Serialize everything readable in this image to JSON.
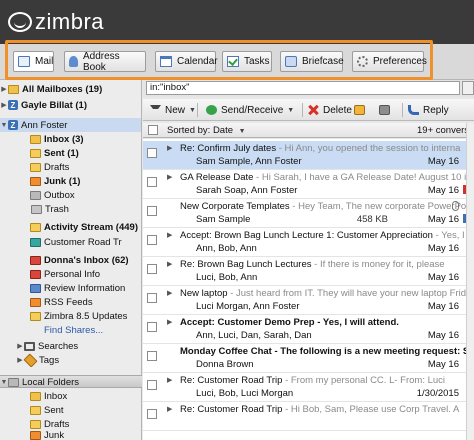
{
  "app": {
    "logo": "zimbra"
  },
  "tabs": [
    {
      "label": "Mail",
      "icon": "mail-icon"
    },
    {
      "label": "Address Book",
      "icon": "contacts-icon"
    },
    {
      "label": "Calendar",
      "icon": "calendar-icon"
    },
    {
      "label": "Tasks",
      "icon": "tasks-icon"
    },
    {
      "label": "Briefcase",
      "icon": "briefcase-icon"
    },
    {
      "label": "Preferences",
      "icon": "gear-icon"
    }
  ],
  "highlight_color": "#f0902a",
  "sidebar": {
    "top": [
      {
        "label": "All Mailboxes (19)"
      },
      {
        "label": "Gayle Billat (1)"
      },
      {
        "label": "Ann Foster"
      }
    ],
    "folders": [
      {
        "label": "Inbox (3)",
        "bold": true
      },
      {
        "label": "Sent (1)",
        "bold": true
      },
      {
        "label": "Drafts"
      },
      {
        "label": "Junk (1)",
        "bold": true
      },
      {
        "label": "Outbox"
      },
      {
        "label": "Trash"
      },
      {
        "label": "Activity Stream (449)",
        "bold": true
      },
      {
        "label": "Customer Road Tr"
      },
      {
        "label": "Donna's Inbox (62)",
        "bold": true
      },
      {
        "label": "Personal Info"
      },
      {
        "label": "Review Information"
      },
      {
        "label": "RSS Feeds"
      },
      {
        "label": "Zimbra 8.5 Updates"
      },
      {
        "label": "Find Shares..."
      },
      {
        "label": "Searches"
      },
      {
        "label": "Tags"
      }
    ],
    "local": {
      "header": "Local Folders",
      "items": [
        {
          "label": "Inbox"
        },
        {
          "label": "Sent"
        },
        {
          "label": "Drafts"
        },
        {
          "label": "Junk"
        }
      ]
    }
  },
  "search": {
    "query": "in:\"inbox\""
  },
  "toolbar": {
    "new": "New",
    "send_receive": "Send/Receive",
    "delete": "Delete",
    "reply": "Reply"
  },
  "list": {
    "sort_label": "Sorted by: Date",
    "count_label": "19+ conversati",
    "messages": [
      {
        "subject": "Re: Confirm July dates",
        "fragment": " - Hi Ann, you opened the session to interna",
        "from": "Sam Sample, Ann Foster",
        "date": "May 16",
        "selected": true,
        "unread": false,
        "arrow": true,
        "flag": ""
      },
      {
        "subject": "GA Release Date",
        "fragment": " - Hi Sarah, I have a GA Release Date! August 10 is the",
        "from": "Sarah Soap, Ann Foster",
        "date": "May 16",
        "unread": false,
        "arrow": true,
        "flag": "red"
      },
      {
        "subject": "New Corporate Templates",
        "fragment": " - Hey Team, The new corporate PowerPo",
        "from": "Sam Sample",
        "size": "458 KB",
        "date": "May 16",
        "unread": false,
        "arrow": false,
        "clip": true,
        "flag": "blue"
      },
      {
        "subject": "Accept: Brown Bag Lunch Lecture 1: Customer Appreciation",
        "fragment": " - Yes, I will attend",
        "from": "Ann, Bob, Ann",
        "date": "May 16",
        "unread": false,
        "arrow": true,
        "flag": ""
      },
      {
        "subject": "Re: Brown Bag Lunch Lectures",
        "fragment": " - If there is money for it, please",
        "from": "Luci, Bob, Ann",
        "date": "May 16",
        "unread": false,
        "arrow": true,
        "flag": ""
      },
      {
        "subject": "New laptop",
        "fragment": " - Just heard from IT. They will have your new laptop Friday at",
        "from": "Luci Morgan, Ann Foster",
        "date": "May 16",
        "unread": false,
        "arrow": true,
        "flag": ""
      },
      {
        "subject": "Accept: Customer Demo Prep - Yes, I will attend.",
        "fragment": "",
        "from": "Ann, Luci, Dan, Sarah, Dan",
        "date": "May 16",
        "unread": true,
        "arrow": true,
        "flag": ""
      },
      {
        "subject": "Monday Coffee Chat - The following is a new meeting request: Subj",
        "fragment": "",
        "from": "Donna Brown",
        "date": "May 16",
        "unread": true,
        "arrow": false,
        "flag": ""
      },
      {
        "subject": "Re: Customer Road Trip",
        "fragment": " - From my personal CC. L- From: Luci",
        "from": "Luci, Bob, Luci Morgan",
        "date": "1/30/2015",
        "unread": false,
        "arrow": true,
        "flag": ""
      },
      {
        "subject": "Re: Customer Road Trip",
        "fragment": " - Hi Bob, Sam, Please use Corp Travel. A",
        "from": "",
        "date": "",
        "unread": false,
        "arrow": true,
        "flag": ""
      }
    ]
  }
}
